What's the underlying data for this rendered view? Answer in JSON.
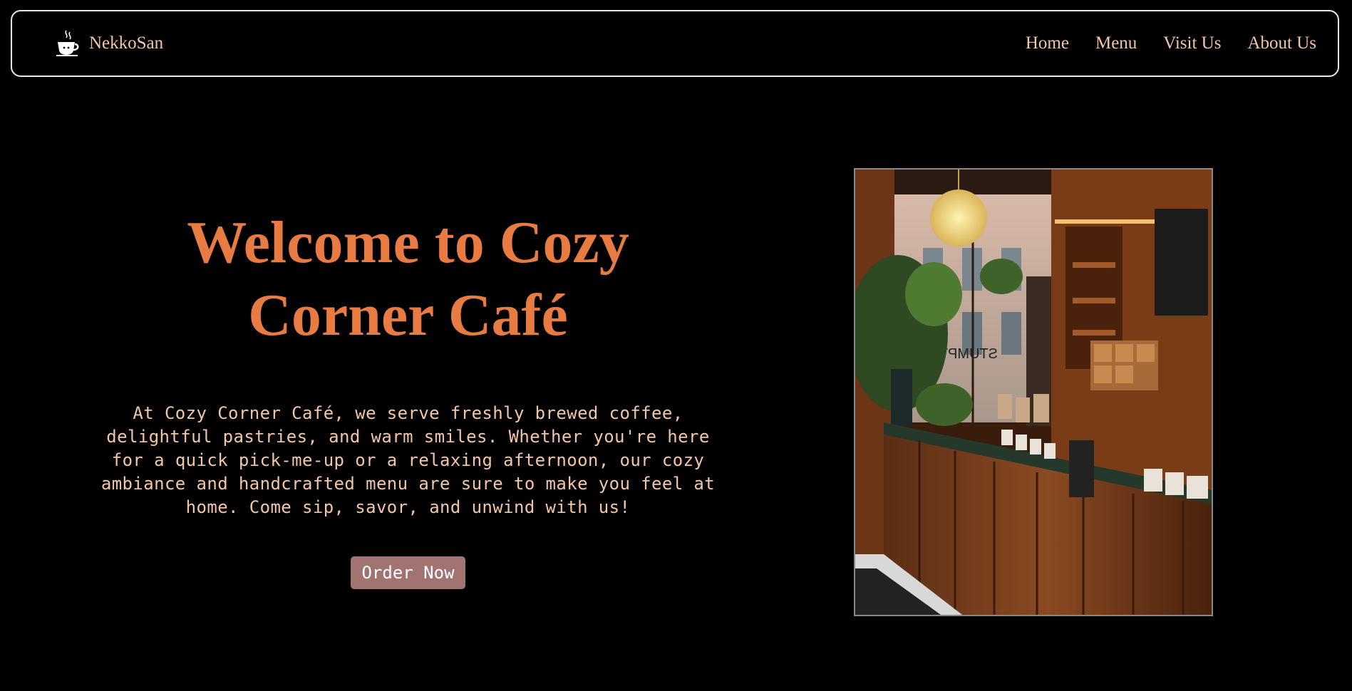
{
  "nav": {
    "brand_name": "NekkoSan",
    "brand_icon": "coffee-cup-icon",
    "links": [
      "Home",
      "Menu",
      "Visit Us",
      "About Us"
    ]
  },
  "hero": {
    "title_line1": "Welcome to Cozy",
    "title_line2": "Corner Café",
    "description": "At Cozy Corner Café, we serve freshly brewed coffee, delightful pastries, and warm smiles. Whether you're here for a quick pick-me-up or a relaxing afternoon, our cozy ambiance and handcrafted menu are sure to make you feel at home. Come sip, savor, and unwind with us!",
    "button_label": "Order Now"
  },
  "photo": {
    "sign_text": "STUMPTOWN"
  },
  "colors": {
    "background": "#000000",
    "accent_title": "#e87b41",
    "text_peach": "#f2c6a6",
    "button": "#a17472"
  }
}
